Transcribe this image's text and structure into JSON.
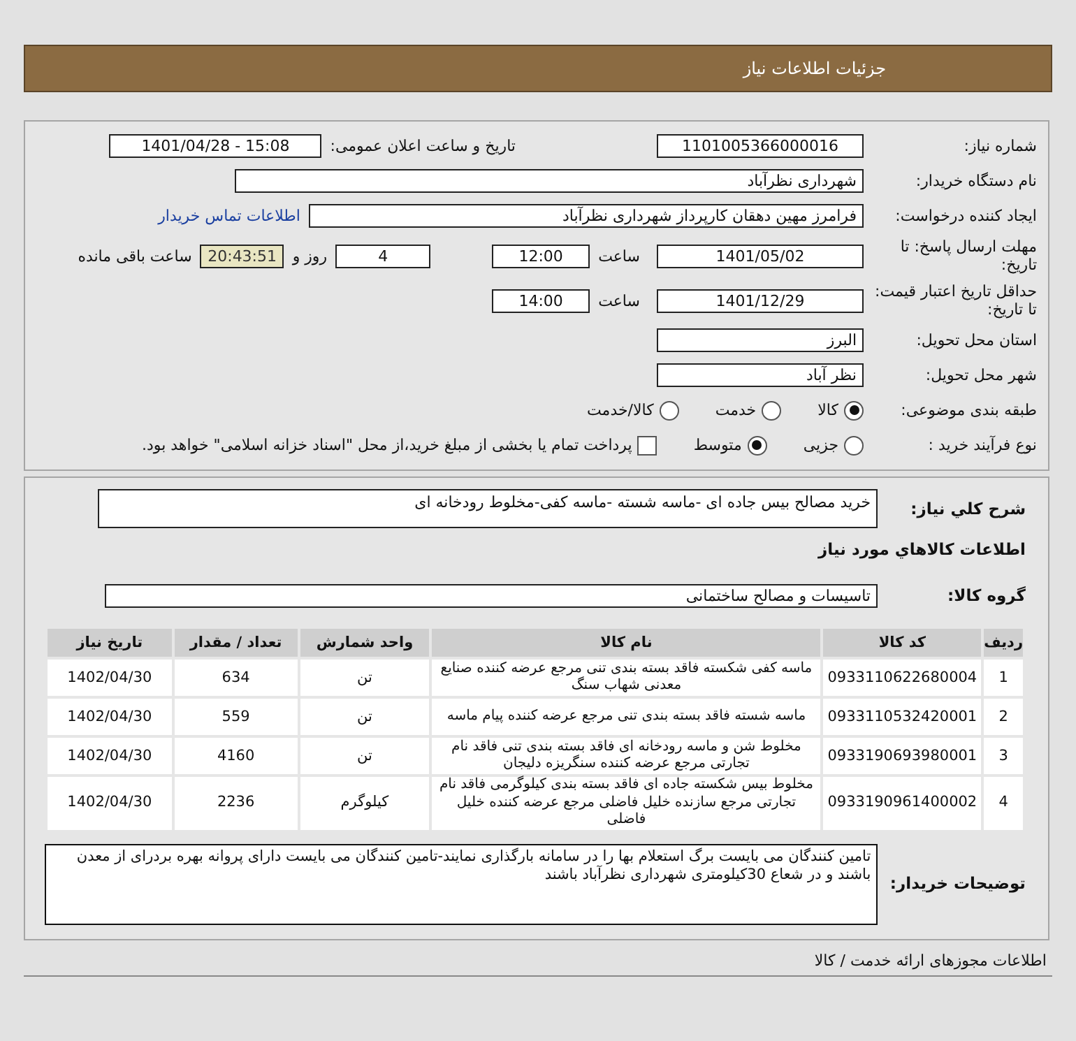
{
  "header": {
    "title": "جزئیات اطلاعات نیاز"
  },
  "need_number": {
    "label": "شماره نیاز:",
    "value": "1101005366000016"
  },
  "announce": {
    "label": "تاریخ و ساعت اعلان عمومی:",
    "value": "1401/04/28 - 15:08"
  },
  "buyer_org": {
    "label": "نام دستگاه خریدار:",
    "value": "شهرداری نظرآباد"
  },
  "requester": {
    "label": "ایجاد کننده درخواست:",
    "value": "فرامرز مهین دهقان کارپرداز شهرداری نظرآباد",
    "link": "اطلاعات تماس خریدار"
  },
  "deadline": {
    "label": "مهلت ارسال پاسخ: تا تاریخ:",
    "date": "1401/05/02",
    "time_label": "ساعت",
    "time": "12:00",
    "days": "4",
    "days_label": "روز و",
    "remaining": "20:43:51",
    "remaining_label": "ساعت باقی مانده"
  },
  "validity": {
    "label": "حداقل تاریخ اعتبار قیمت: تا تاریخ:",
    "date": "1401/12/29",
    "time_label": "ساعت",
    "time": "14:00"
  },
  "province": {
    "label": "استان محل تحویل:",
    "value": "البرز"
  },
  "city": {
    "label": "شهر محل تحویل:",
    "value": "نظر آباد"
  },
  "category": {
    "label": "طبقه بندی موضوعی:",
    "options": [
      {
        "label": "کالا",
        "selected": true
      },
      {
        "label": "خدمت",
        "selected": false
      },
      {
        "label": "کالا/خدمت",
        "selected": false
      }
    ]
  },
  "process": {
    "label": "نوع فرآیند خرید :",
    "options": [
      {
        "label": "جزیی",
        "selected": false
      },
      {
        "label": "متوسط",
        "selected": true
      }
    ],
    "payment": {
      "label": "پرداخت تمام یا بخشی از مبلغ خرید،از محل \"اسناد خزانه اسلامی\" خواهد بود.",
      "checked": false
    }
  },
  "description": {
    "label": "شرح کلي نياز:",
    "value": "خرید مصالح بیس جاده ای -ماسه شسته -ماسه کفی-مخلوط رودخانه ای"
  },
  "goods_title": "اطلاعات کالاهاي مورد نياز",
  "group": {
    "label": "گروه کالا:",
    "value": "تاسیسات و مصالح ساختمانی"
  },
  "table": {
    "columns": [
      "ردیف",
      "کد کالا",
      "نام کالا",
      "واحد شمارش",
      "تعداد / مقدار",
      "تاریخ نیاز"
    ],
    "rows": [
      [
        "1",
        "0933110622680004",
        "ماسه کفی شکسته فاقد بسته بندی تنی مرجع عرضه کننده صنایع معدنی شهاب سنگ",
        "تن",
        "634",
        "1402/04/30"
      ],
      [
        "2",
        "0933110532420001",
        "ماسه شسته فاقد بسته بندی تنی مرجع عرضه کننده پیام ماسه",
        "تن",
        "559",
        "1402/04/30"
      ],
      [
        "3",
        "0933190693980001",
        "مخلوط شن و ماسه رودخانه ای فاقد بسته بندی تنی فاقد نام تجارتی مرجع عرضه کننده سنگریزه دلیجان",
        "تن",
        "4160",
        "1402/04/30"
      ],
      [
        "4",
        "0933190961400002",
        "مخلوط بیس شکسته جاده ای فاقد بسته بندی کیلوگرمی فاقد نام تجارتی مرجع سازنده خلیل فاضلی مرجع عرضه کننده خلیل فاضلی",
        "کیلوگرم",
        "2236",
        "1402/04/30"
      ]
    ]
  },
  "buyer_notes": {
    "label": "توضیحات خریدار:",
    "value": "تامین کنندگان می بایست برگ استعلام بها را در سامانه بارگذاری نمایند-تامین کنندگان می بایست دارای  پروانه بهره بردرای از معدن باشند و در شعاع 30کیلومتری شهرداری نظرآباد باشند"
  },
  "footer": {
    "title": "اطلاعات مجوزهای ارائه خدمت / کالا"
  }
}
